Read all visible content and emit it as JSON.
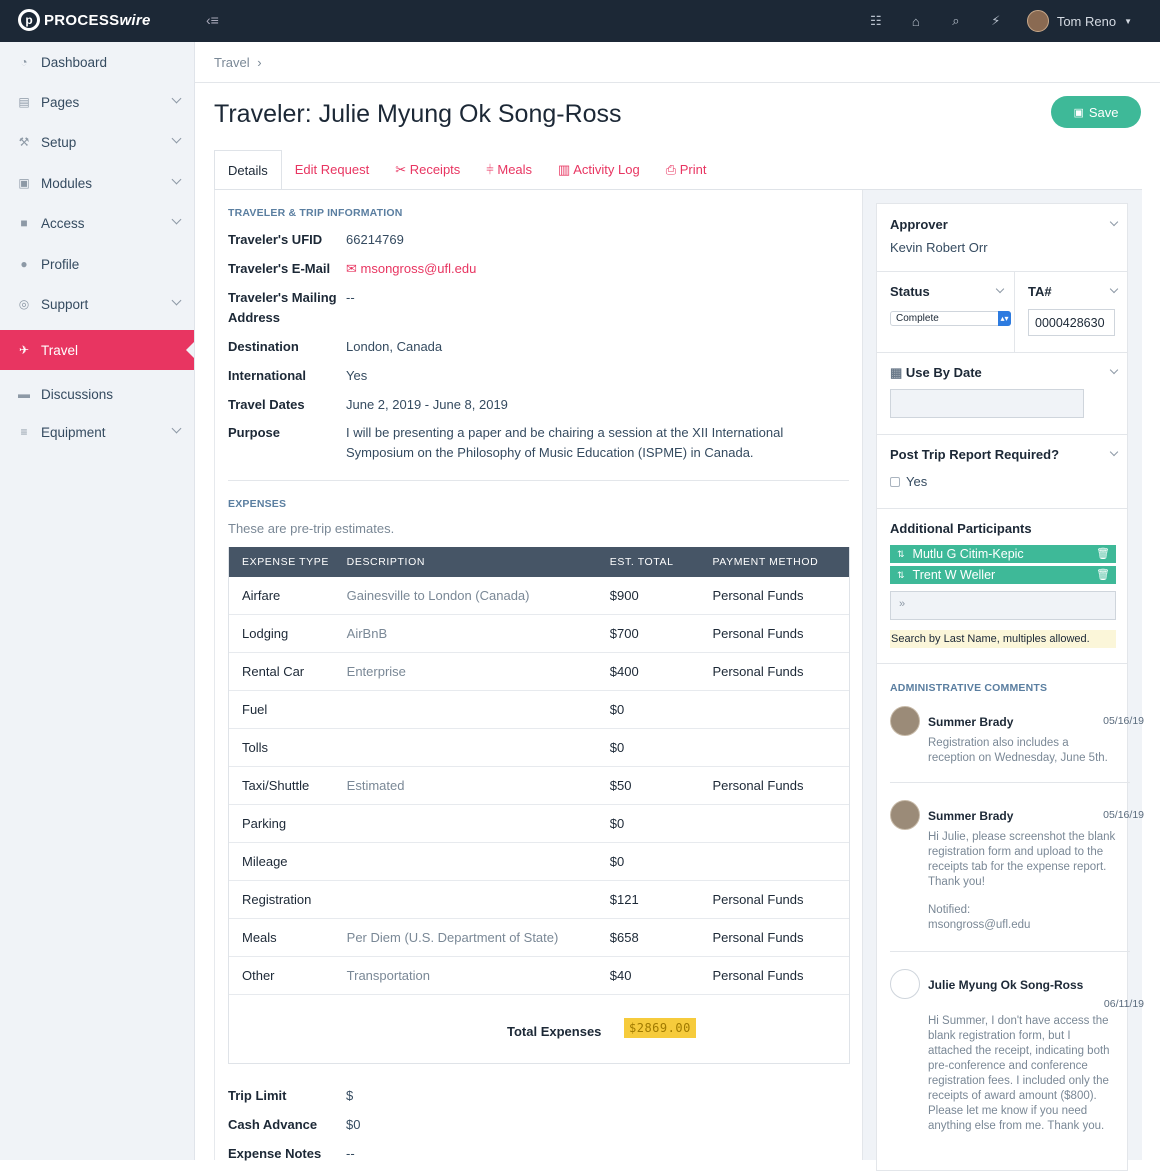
{
  "brand": {
    "mark": "p",
    "name_a": "PROCESS",
    "name_b": "wire"
  },
  "topbar": {
    "toggle": "‹≡",
    "icons": [
      "sitemap-icon",
      "home-icon",
      "search-icon",
      "bolt-icon"
    ],
    "user": "Tom Reno"
  },
  "sidebar": {
    "items": [
      {
        "label": "Dashboard",
        "icon": "dashboard-icon",
        "chev": false
      },
      {
        "label": "Pages",
        "icon": "pages-icon",
        "chev": true
      },
      {
        "label": "Setup",
        "icon": "wrench-icon",
        "chev": true
      },
      {
        "label": "Modules",
        "icon": "briefcase-icon",
        "chev": true
      },
      {
        "label": "Access",
        "icon": "unlock-icon",
        "chev": true
      },
      {
        "label": "Profile",
        "icon": "user-icon",
        "chev": false
      },
      {
        "label": "Support",
        "icon": "lifebuoy-icon",
        "chev": true
      },
      {
        "label": "Travel",
        "icon": "plane-icon",
        "chev": false
      },
      {
        "label": "Discussions",
        "icon": "comments-icon",
        "chev": false
      },
      {
        "label": "Equipment",
        "icon": "database-icon",
        "chev": true
      }
    ]
  },
  "breadcrumb": "Travel",
  "page": {
    "title": "Traveler: Julie Myung Ok Song-Ross",
    "save": "Save"
  },
  "tabs": [
    "Details",
    "Edit Request",
    "Receipts",
    "Meals",
    "Activity Log",
    "Print"
  ],
  "traveler": {
    "heading": "TRAVELER & TRIP INFORMATION",
    "fields": [
      {
        "label": "Traveler's UFID",
        "value": "66214769"
      },
      {
        "label": "Traveler's E-Mail",
        "value": "msongross@ufl.edu"
      },
      {
        "label": "Traveler's Mailing Address",
        "value": "--"
      },
      {
        "label": "Destination",
        "value": "London, Canada"
      },
      {
        "label": "International",
        "value": "Yes"
      },
      {
        "label": "Travel Dates",
        "value": "June 2, 2019 - June 8, 2019"
      },
      {
        "label": "Purpose",
        "value": "I will be presenting a paper and be chairing a session at the XII International Symposium on the Philosophy of Music Education (ISPME) in Canada."
      }
    ]
  },
  "expenses": {
    "heading": "EXPENSES",
    "note": "These are pre-trip estimates.",
    "columns": [
      "EXPENSE TYPE",
      "DESCRIPTION",
      "EST. TOTAL",
      "PAYMENT METHOD"
    ],
    "rows": [
      [
        "Airfare",
        "Gainesville to London (Canada)",
        "$900",
        "Personal Funds"
      ],
      [
        "Lodging",
        "AirBnB",
        "$700",
        "Personal Funds"
      ],
      [
        "Rental Car",
        "Enterprise",
        "$400",
        "Personal Funds"
      ],
      [
        "Fuel",
        "",
        "$0",
        ""
      ],
      [
        "Tolls",
        "",
        "$0",
        ""
      ],
      [
        "Taxi/Shuttle",
        "Estimated",
        "$50",
        "Personal Funds"
      ],
      [
        "Parking",
        "",
        "$0",
        ""
      ],
      [
        "Mileage",
        "",
        "$0",
        ""
      ],
      [
        "Registration",
        "",
        "$121",
        "Personal Funds"
      ],
      [
        "Meals",
        "Per Diem (U.S. Department of State)",
        "$658",
        "Personal Funds"
      ],
      [
        "Other",
        "Transportation",
        "$40",
        "Personal Funds"
      ]
    ],
    "total_label": "Total Expenses",
    "total_value": "$2869.00"
  },
  "footer_fields": [
    {
      "label": "Trip Limit",
      "value": "$"
    },
    {
      "label": "Cash Advance",
      "value": "$0"
    },
    {
      "label": "Expense Notes",
      "value": "--"
    }
  ],
  "right": {
    "approver_label": "Approver",
    "approver_value": "Kevin Robert Orr",
    "status_label": "Status",
    "status_value": "Complete",
    "ta_label": "TA#",
    "ta_value": "0000428630",
    "usebydate_label": "Use By Date",
    "posttrip_label": "Post Trip Report Required?",
    "posttrip_option": "Yes",
    "participants_label": "Additional Participants",
    "participants": [
      "Mutlu G Citim-Kepic",
      "Trent W Weller"
    ],
    "participants_input": "»",
    "participants_hint": "Search by Last Name, multiples allowed.",
    "comments_heading": "ADMINISTRATIVE COMMENTS",
    "comments": [
      {
        "name": "Summer Brady",
        "date": "05/16/19",
        "text": "Registration also includes a reception on Wednesday, June 5th.",
        "notified_label": "",
        "notified_value": ""
      },
      {
        "name": "Summer Brady",
        "date": "05/16/19",
        "text": "Hi Julie, please screenshot the blank registration form and upload to the receipts tab for the expense report. Thank you!",
        "notified_label": "Notified:",
        "notified_value": "msongross@ufl.edu"
      },
      {
        "name": "Julie Myung Ok Song-Ross",
        "date": "06/11/19",
        "text": "Hi Summer, I don't have access the blank registration form, but I attached the receipt, indicating both pre-conference and conference registration fees. I included only the receipts of award amount ($800). Please let me know if you need anything else from me. Thank you.",
        "notified_label": "",
        "notified_value": ""
      }
    ]
  }
}
